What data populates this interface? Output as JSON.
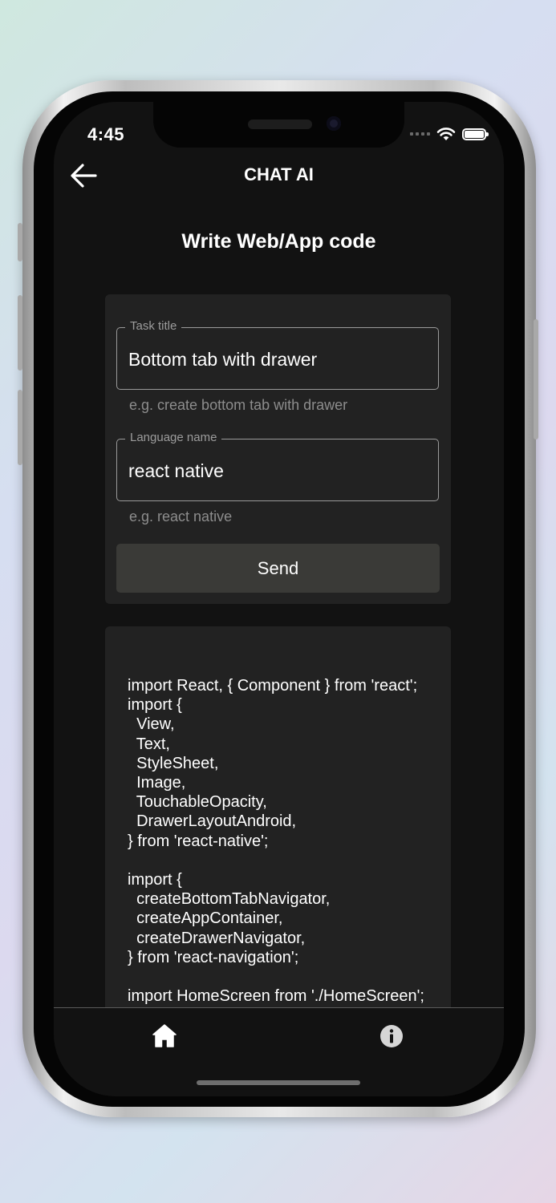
{
  "status_bar": {
    "time": "4:45",
    "icons": [
      "signal-icon",
      "wifi-icon",
      "battery-icon"
    ]
  },
  "header": {
    "back_icon": "arrow-left-icon",
    "title": "CHAT AI"
  },
  "page": {
    "heading": "Write Web/App code"
  },
  "form": {
    "task_title": {
      "label": "Task title",
      "value": "Bottom tab with drawer",
      "hint": "e.g. create bottom tab with drawer"
    },
    "language": {
      "label": "Language name",
      "value": "react native",
      "hint": "e.g. react native"
    },
    "send_label": "Send"
  },
  "code_output": {
    "text": "import React, { Component } from 'react';\nimport {\n  View,\n  Text,\n  StyleSheet,\n  Image,\n  TouchableOpacity,\n  DrawerLayoutAndroid,\n} from 'react-native';\n\nimport {\n  createBottomTabNavigator,\n  createAppContainer,\n  createDrawerNavigator,\n} from 'react-navigation';\n\nimport HomeScreen from './HomeScreen';"
  },
  "tab_bar": {
    "items": [
      {
        "icon": "home-icon"
      },
      {
        "icon": "info-icon"
      }
    ]
  },
  "colors": {
    "background": "#121212",
    "card": "#222222",
    "button": "#3a3a37",
    "hint_text": "#8d8d8d",
    "border": "#9a9a9a"
  }
}
